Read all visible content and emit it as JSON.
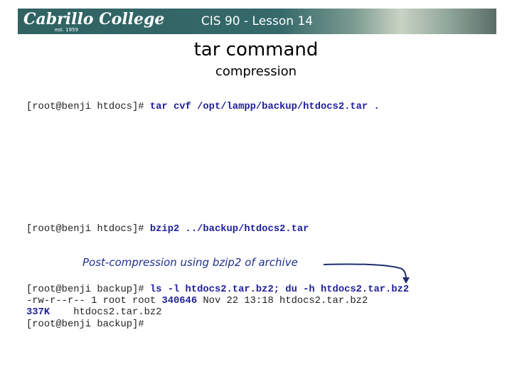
{
  "header": {
    "logo": "Cabrillo College",
    "logo_est": "est. 1959",
    "course": "CIS 90 - Lesson 14",
    "color": "#35696a"
  },
  "title": "tar command",
  "subtitle": "compression",
  "terminal": {
    "line1": {
      "prompt": "[root@benji htdocs]# ",
      "cmd": "tar cvf /opt/lampp/backup/htdocs2.tar ."
    },
    "line2": {
      "prompt": "[root@benji htdocs]# ",
      "cmd": "bzip2 ../backup/htdocs2.tar"
    },
    "line3": {
      "prompt": "[root@benji backup]# ",
      "cmd": "ls -l htdocs2.tar.bz2; du -h htdocs2.tar.bz2"
    },
    "line4": {
      "pre": "-rw-r--r-- 1 root root ",
      "size": "340646",
      "post": " Nov 22 13:18 htdocs2.tar.bz2"
    },
    "line5": {
      "size": "337K",
      "post": "    htdocs2.tar.bz2"
    },
    "line6": {
      "prompt": "[root@benji backup]#"
    }
  },
  "annotation": "Post-compression using bzip2 of archive",
  "colors": {
    "command": "#1f1f9a",
    "annotation": "#1f2f8f"
  }
}
